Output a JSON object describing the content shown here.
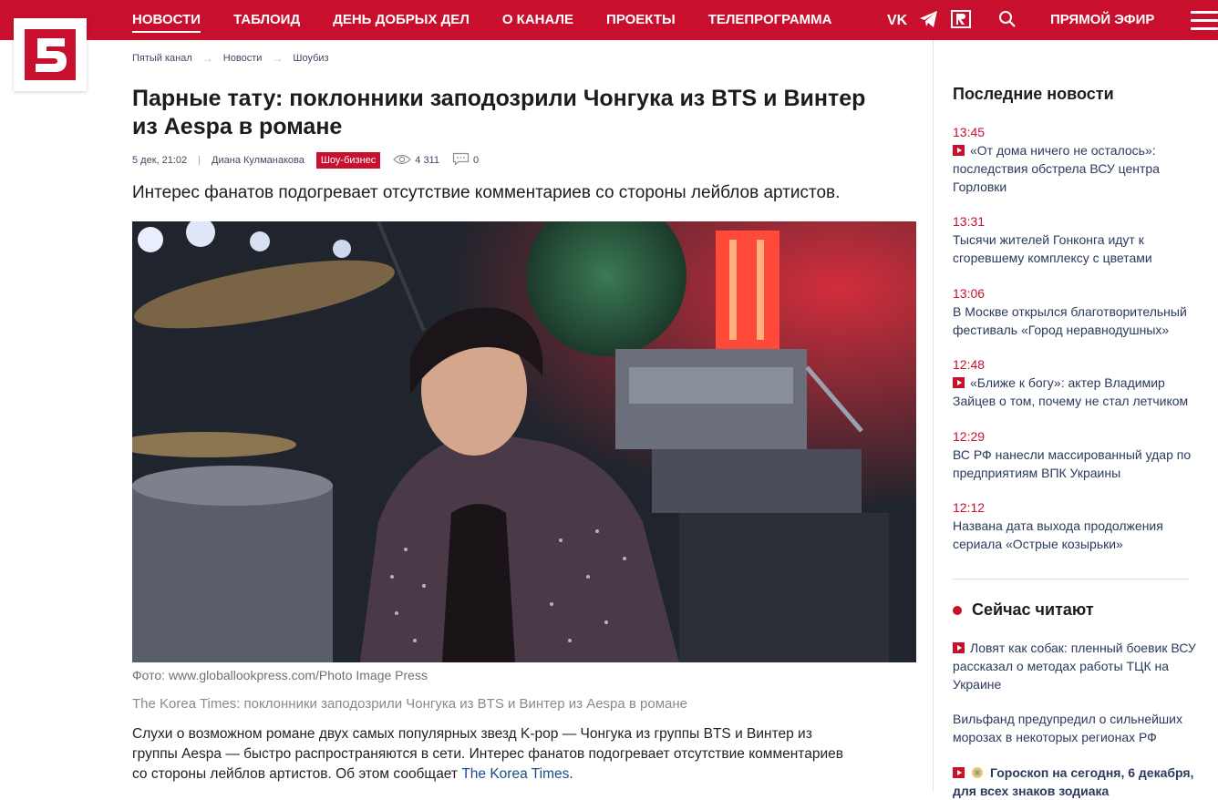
{
  "nav": {
    "items": [
      "НОВОСТИ",
      "ТАБЛОИД",
      "ДЕНЬ ДОБРЫХ ДЕЛ",
      "О КАНАЛЕ",
      "ПРОЕКТЫ",
      "ТЕЛЕПРОГРАММА"
    ],
    "live_label": "ПРЯМОЙ ЭФИР",
    "social": [
      "vk-icon",
      "telegram-icon",
      "rutube-icon"
    ]
  },
  "logo": {
    "text": "5"
  },
  "breadcrumb": [
    "Пятый канал",
    "Новости",
    "Шоубиз"
  ],
  "article": {
    "title": "Парные тату: поклонники заподозрили Чонгука из BTS и Винтер из Aespa в романе",
    "date": "5 дек, 21:02",
    "author": "Диана Кулманакова",
    "tag": "Шоу-бизнес",
    "views": "4 311",
    "comments": "0",
    "lead": "Интерес фанатов подогревает отсутствие комментариев со стороны лейблов артистов.",
    "photo_credit": "Фото: www.globallookpress.com/Photo Image Press",
    "caption": "The Korea Times: поклонники заподозрили Чонгука из BTS и Винтер из Aespa в романе",
    "body_text": "Слухи о возможном романе двух самых популярных звезд K-pop — Чонгука из группы BTS и Винтер из группы Aespa — быстро распространяются в сети. Интерес фанатов подогревает отсутствие комментариев со стороны лейблов артистов. Об этом сообщает ",
    "body_link": "The Korea Times",
    "body_end": "."
  },
  "sidebar": {
    "latest_title": "Последние новости",
    "latest": [
      {
        "time": "13:45",
        "text": "«От дома ничего не осталось»: последствия обстрела ВСУ центра Горловки",
        "video": true
      },
      {
        "time": "13:31",
        "text": "Тысячи жителей Гонконга идут к сгоревшему комплексу с цветами",
        "video": false
      },
      {
        "time": "13:06",
        "text": "В Москве открылся благотворительный фестиваль «Город неравнодушных»",
        "video": false
      },
      {
        "time": "12:48",
        "text": "«Ближе к богу»: актер Владимир Зайцев о том, почему не стал летчиком",
        "video": true
      },
      {
        "time": "12:29",
        "text": "ВС РФ нанесли массированный удар по предприятиям ВПК Украины",
        "video": false
      },
      {
        "time": "12:12",
        "text": "Названа дата выхода продолжения сериала «Острые козырьки»",
        "video": false
      }
    ],
    "reading_title": "Сейчас читают",
    "reading": [
      {
        "text": "Ловят как собак: пленный боевик ВСУ рассказал о методах работы ТЦК на Украине",
        "video": true
      },
      {
        "text": "Вильфанд предупредил о сильнейших морозах в некоторых регионах РФ",
        "video": false
      },
      {
        "text": "Гороскоп на сегодня, 6 декабря, для всех знаков зодиака",
        "video": true
      }
    ]
  },
  "colors": {
    "brand": "#c8102e",
    "link": "#2b3a5c"
  }
}
